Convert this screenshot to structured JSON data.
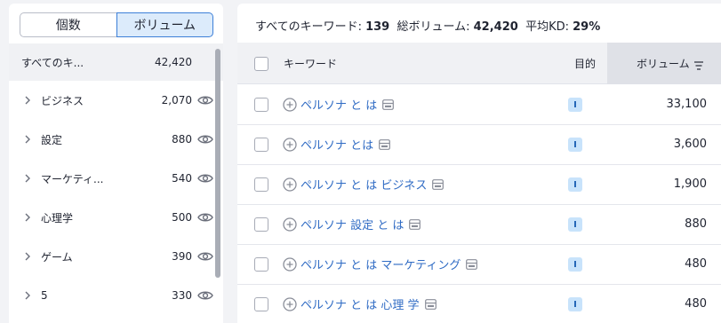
{
  "segmented": {
    "count_label": "個数",
    "volume_label": "ボリューム"
  },
  "groups": [
    {
      "label": "すべてのキ...",
      "count": "42,420"
    },
    {
      "label": "ビジネス",
      "count": "2,070"
    },
    {
      "label": "設定",
      "count": "880"
    },
    {
      "label": "マーケティ...",
      "count": "540"
    },
    {
      "label": "心理学",
      "count": "500"
    },
    {
      "label": "ゲーム",
      "count": "390"
    },
    {
      "label": "5",
      "count": "330"
    }
  ],
  "summary": {
    "all_kw_label": "すべてのキーワード:",
    "all_kw_value": "139",
    "total_vol_label": "総ボリューム:",
    "total_vol_value": "42,420",
    "avg_kd_label": "平均KD:",
    "avg_kd_value": "29%"
  },
  "table": {
    "headers": {
      "keyword": "キーワード",
      "intent": "目的",
      "volume": "ボリューム"
    },
    "rows": [
      {
        "keyword": "ペルソナ と は",
        "intent": "I",
        "volume": "33,100"
      },
      {
        "keyword": "ペルソナ とは",
        "intent": "I",
        "volume": "3,600"
      },
      {
        "keyword": "ペルソナ と は ビジネス",
        "intent": "I",
        "volume": "1,900"
      },
      {
        "keyword": "ペルソナ 設定 と は",
        "intent": "I",
        "volume": "880"
      },
      {
        "keyword": "ペルソナ と は マーケティング",
        "intent": "I",
        "volume": "480"
      },
      {
        "keyword": "ペルソナ と は 心理 学",
        "intent": "I",
        "volume": "480"
      }
    ]
  },
  "colors": {
    "accent": "#3c7fd8",
    "link": "#2f6bc4",
    "intent_badge_bg": "#c8e3fb"
  },
  "icons": {
    "expand": "chevron-right-icon",
    "visibility": "eye-icon",
    "add": "plus-circle-icon",
    "serp": "serp-features-icon",
    "sort": "sort-icon"
  }
}
